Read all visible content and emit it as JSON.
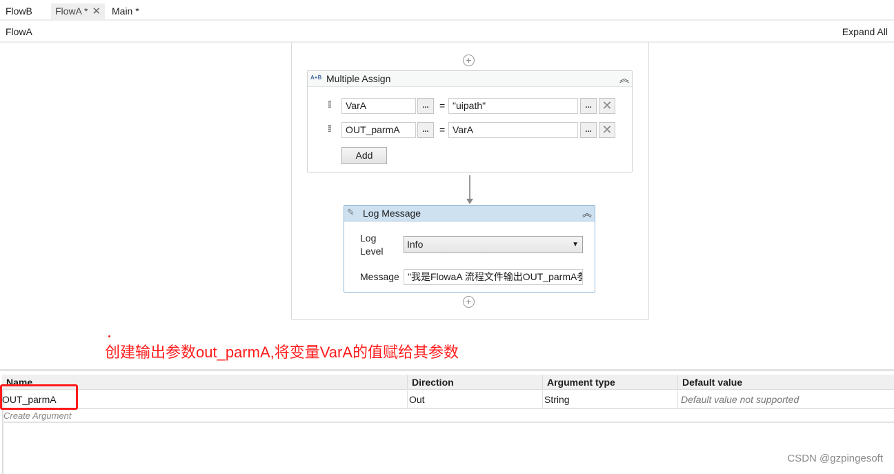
{
  "tabs": [
    {
      "label": "FlowB",
      "active": false
    },
    {
      "label": "FlowA *",
      "active": true,
      "close_icon": "close-icon"
    },
    {
      "label": "Main *",
      "active": false
    }
  ],
  "breadcrumb": "FlowA",
  "expand_all_label": "Expand All",
  "multiple_assign": {
    "title": "Multiple Assign",
    "icon": "A+B",
    "rows": [
      {
        "to": "VarA",
        "value": "\"uipath\""
      },
      {
        "to": "OUT_parmA",
        "value": "VarA"
      }
    ],
    "ellipsis": "...",
    "equals": "=",
    "add_label": "Add"
  },
  "log_message": {
    "title": "Log Message",
    "log_level_label": "Log\nLevel",
    "log_level_label_line1": "Log",
    "log_level_label_line2": "Level",
    "log_level_value": "Info",
    "message_label": "Message",
    "message_value": "\"我是FlowaA 流程文件输出OUT_parmA参"
  },
  "annotation": "创建输出参数out_parmA,将变量VarA的值赋给其参数",
  "arguments": {
    "columns": [
      "Name",
      "Direction",
      "Argument type",
      "Default value"
    ],
    "rows": [
      {
        "name": "OUT_parmA",
        "direction": "Out",
        "type": "String",
        "default": "Default value not supported"
      }
    ],
    "create_label": "Create Argument"
  },
  "watermark": "CSDN @gzpingesoft",
  "colors": {
    "annotation": "#ff1a1a",
    "log_header": "#cde1f1"
  }
}
